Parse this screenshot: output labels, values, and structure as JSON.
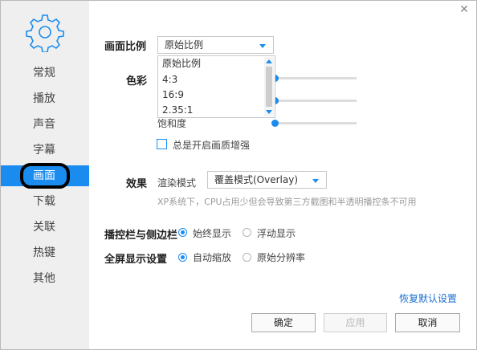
{
  "window": {
    "close_glyph": "✕"
  },
  "sidebar": {
    "items": [
      {
        "label": "常规",
        "active": false
      },
      {
        "label": "播放",
        "active": false
      },
      {
        "label": "声音",
        "active": false
      },
      {
        "label": "字幕",
        "active": false
      },
      {
        "label": "画面",
        "active": true
      },
      {
        "label": "下载",
        "active": false
      },
      {
        "label": "关联",
        "active": false
      },
      {
        "label": "热键",
        "active": false
      },
      {
        "label": "其他",
        "active": false
      }
    ]
  },
  "aspect": {
    "label": "画面比例",
    "selected": "原始比例",
    "options": [
      "原始比例",
      "4:3",
      "16:9",
      "2.35:1"
    ]
  },
  "color": {
    "label": "色彩",
    "saturation_label": "饱和度",
    "sliders": [
      {
        "name": "slider-1",
        "level": 0.0
      },
      {
        "name": "slider-2",
        "level": 0.0
      },
      {
        "name": "saturation",
        "level": 0.0
      }
    ]
  },
  "enhance": {
    "label": "总是开启画质增强",
    "checked": false
  },
  "effect": {
    "label": "效果",
    "render_label": "渲染模式",
    "render_value": "覆盖模式(Overlay)",
    "hint": "XP系统下，CPU占用少但会导致第三方截图和半透明播控条不可用"
  },
  "controlbar": {
    "label": "播控栏与侧边栏",
    "options": [
      {
        "label": "始终显示",
        "selected": true
      },
      {
        "label": "浮动显示",
        "selected": false
      }
    ]
  },
  "fullscreen": {
    "label": "全屏显示设置",
    "options": [
      {
        "label": "自动缩放",
        "selected": true
      },
      {
        "label": "原始分辨率",
        "selected": false
      }
    ]
  },
  "restore_link": "恢复默认设置",
  "buttons": {
    "ok": "确定",
    "apply": "应用",
    "cancel": "取消"
  },
  "colors": {
    "accent": "#1a8cf0",
    "sidebar_bg": "#efefef",
    "link": "#1a6fd0"
  }
}
